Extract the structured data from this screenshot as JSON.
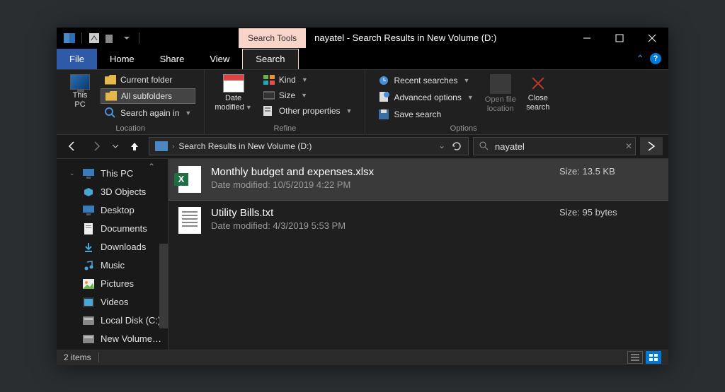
{
  "titlebar": {
    "context_tab": "Search Tools",
    "title": "nayatel - Search Results in New Volume (D:)"
  },
  "tabs": {
    "file": "File",
    "items": [
      "Home",
      "Share",
      "View",
      "Search"
    ],
    "active": "Search"
  },
  "ribbon": {
    "location": {
      "current_folder": "Current folder",
      "all_subfolders": "All subfolders",
      "search_again_in": "Search again in",
      "this_pc": "This\nPC",
      "label": "Location"
    },
    "refine": {
      "date_modified": "Date\nmodified",
      "kind": "Kind",
      "size": "Size",
      "other": "Other properties",
      "label": "Refine"
    },
    "options": {
      "recent": "Recent searches",
      "advanced": "Advanced options",
      "save": "Save search",
      "open_location": "Open file\nlocation",
      "close_search": "Close\nsearch",
      "label": "Options"
    }
  },
  "address": {
    "path": "Search Results in New Volume (D:)"
  },
  "search": {
    "value": "nayatel"
  },
  "nav": {
    "root": "This PC",
    "items": [
      "3D Objects",
      "Desktop",
      "Documents",
      "Downloads",
      "Music",
      "Pictures",
      "Videos",
      "Local Disk (C:)",
      "New Volume (D:)"
    ]
  },
  "results": [
    {
      "name": "Monthly budget and expenses.xlsx",
      "modified": "Date modified: 10/5/2019 4:22 PM",
      "size": "Size: 13.5 KB",
      "type": "xlsx"
    },
    {
      "name": "Utility Bills.txt",
      "modified": "Date modified: 4/3/2019 5:53 PM",
      "size": "Size: 95 bytes",
      "type": "txt"
    }
  ],
  "status": {
    "count": "2 items"
  }
}
